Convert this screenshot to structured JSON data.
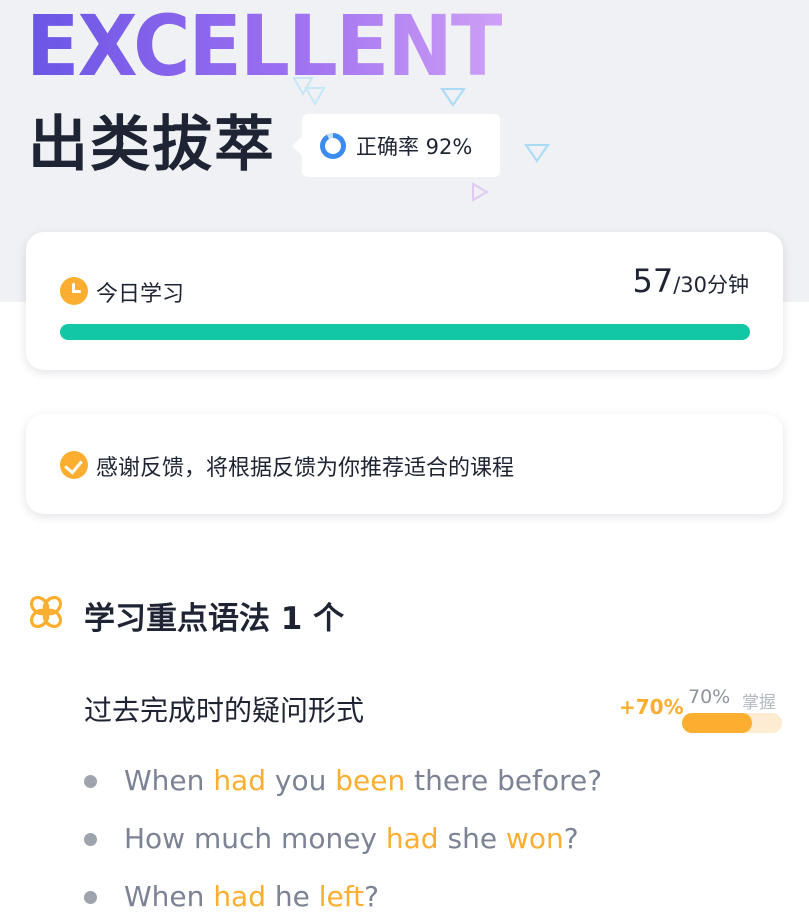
{
  "hero": {
    "title": "EXCELLENT",
    "subtitle": "出类拔萃",
    "accuracy_label": "正确率 92%",
    "accuracy": 0.92
  },
  "study": {
    "label": "今日学习",
    "minutes": "57",
    "goal": "/30分钟",
    "progress": 1.0
  },
  "feedback": {
    "text": "感谢反馈，将根据反馈为你推荐适合的课程"
  },
  "grammar_section": {
    "title": "学习重点语法 1 个"
  },
  "grammar_item": {
    "name": "过去完成时的疑问形式",
    "gain": "+70%",
    "mastery_percent": "70%",
    "mastery_label": "掌握",
    "mastery": 0.7
  },
  "examples": [
    [
      {
        "t": "When ",
        "h": false
      },
      {
        "t": "had",
        "h": true
      },
      {
        "t": " you ",
        "h": false
      },
      {
        "t": "been",
        "h": true
      },
      {
        "t": " there before?",
        "h": false
      }
    ],
    [
      {
        "t": "How much money ",
        "h": false
      },
      {
        "t": "had",
        "h": true
      },
      {
        "t": " she ",
        "h": false
      },
      {
        "t": "won",
        "h": true
      },
      {
        "t": "?",
        "h": false
      }
    ],
    [
      {
        "t": "When ",
        "h": false
      },
      {
        "t": "had",
        "h": true
      },
      {
        "t": " he ",
        "h": false
      },
      {
        "t": "left",
        "h": true
      },
      {
        "t": "?",
        "h": false
      }
    ]
  ],
  "colors": {
    "accent": "#fbae30",
    "progress": "#12c7a4",
    "title_gradient_start": "#6a55e6",
    "title_gradient_end": "#cfa0f6"
  },
  "icons": [
    "clock-icon",
    "check-circle-icon",
    "grammar-flower-icon",
    "accuracy-ring-icon"
  ]
}
